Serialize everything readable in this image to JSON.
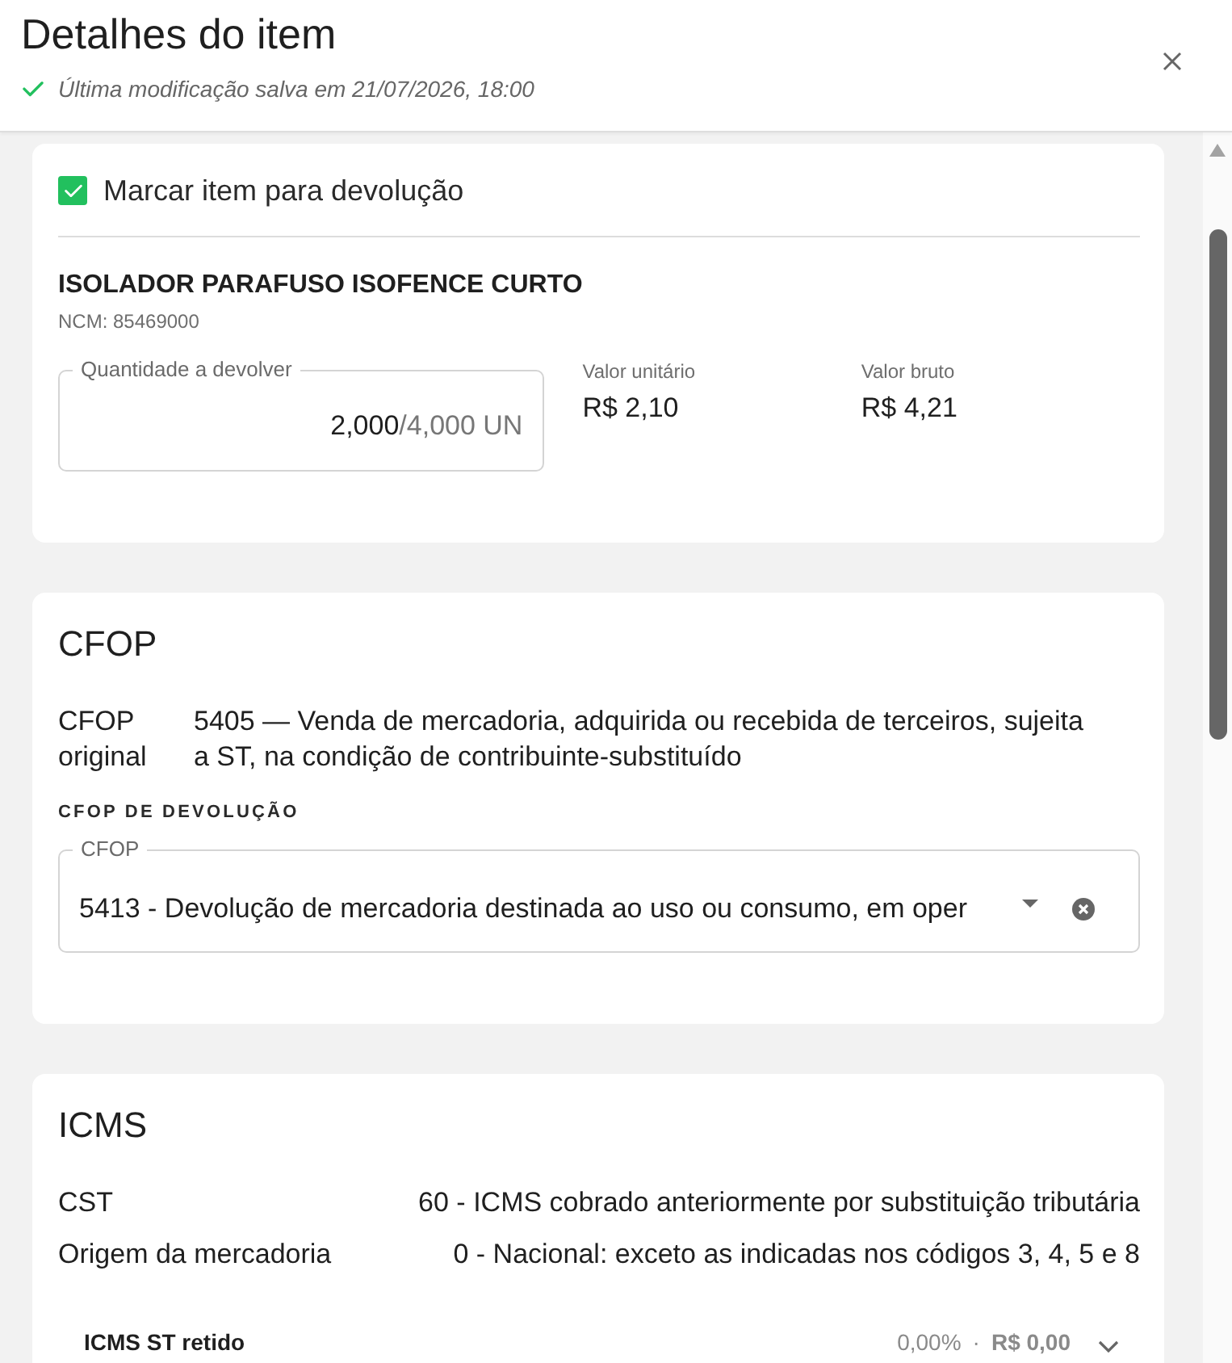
{
  "header": {
    "title": "Detalhes do item",
    "saved_status": "Última modificação salva em 21/07/2026, 18:00"
  },
  "item_card": {
    "return_checkbox": {
      "label": "Marcar item para devolução",
      "checked": true
    },
    "product_name": "ISOLADOR PARAFUSO ISOFENCE CURTO",
    "ncm": "NCM: 85469000",
    "quantity_field": {
      "label": "Quantidade a devolver",
      "value": "2,000",
      "total": "/4,000 UN"
    },
    "values": [
      {
        "label": "Valor unitário",
        "value": "R$ 2,10"
      },
      {
        "label": "Valor bruto",
        "value": "R$ 4,21"
      }
    ]
  },
  "cfop_card": {
    "title": "CFOP",
    "original": {
      "label": "CFOP original",
      "value": "5405 — Venda de mercadoria, adquirida ou recebida de terceiros, sujeita a ST, na condição de contribuinte-substituído"
    },
    "return_section_label": "CFOP DE DEVOLUÇÃO",
    "return_select": {
      "label": "CFOP",
      "value": "5413 - Devolução de mercadoria destinada ao uso ou consumo, em oper"
    }
  },
  "icms_card": {
    "title": "ICMS",
    "rows": [
      {
        "label": "CST",
        "value": "60 - ICMS cobrado anteriormente por substituição tributária"
      },
      {
        "label": "Origem da mercadoria",
        "value": "0 - Nacional: exceto as indicadas nos códigos 3, 4, 5 e 8"
      }
    ],
    "sections": [
      {
        "title": "ICMS ST retido",
        "rate": "0,00%",
        "separator": "·",
        "amount": "R$ 0,00",
        "expanded": false
      }
    ]
  }
}
